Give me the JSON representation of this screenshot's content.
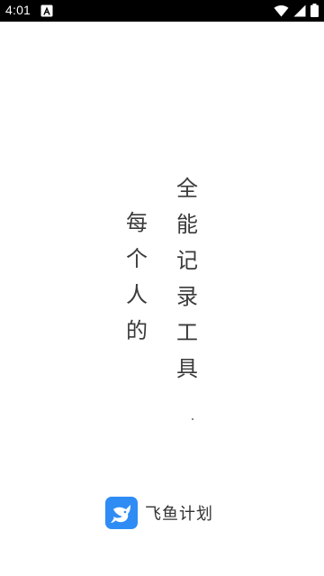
{
  "status_bar": {
    "time": "4:01",
    "icons": [
      "a-notification-icon",
      "wifi-icon",
      "cell-signal-icon",
      "battery-icon"
    ]
  },
  "splash": {
    "column_right": [
      "全",
      "能",
      "记",
      "录",
      "工",
      "具"
    ],
    "column_left": [
      "每",
      "个",
      "人",
      "的"
    ],
    "text_color": "#3a3a3a"
  },
  "brand": {
    "name": "飞鱼计划",
    "logo": "flying-fish-logo-icon",
    "logo_color": "#2f8cf5"
  }
}
